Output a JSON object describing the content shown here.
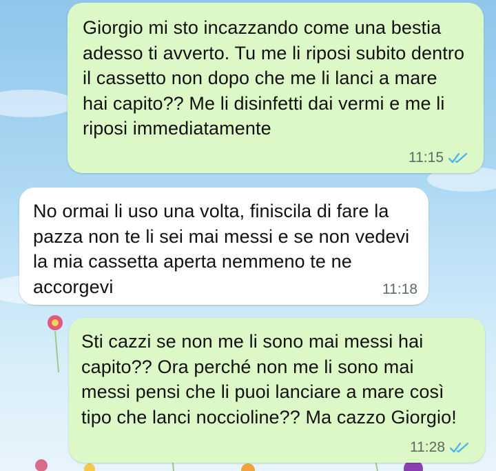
{
  "messages": [
    {
      "direction": "outgoing",
      "text": "Giorgio mi sto incazzando come una bestia adesso ti avverto. Tu me li riposi subito dentro il cassetto non dopo che me li lanci a mare hai capito?? Me li disinfetti dai vermi e me li riposi immediatamente",
      "time": "11:15",
      "status": "read"
    },
    {
      "direction": "incoming",
      "text": "No ormai li uso una volta, finiscila di fare la pazza non te li sei mai messi e se non vedevi la mia cassetta aperta nemmeno te ne accorgevi",
      "time": "11:18"
    },
    {
      "direction": "outgoing",
      "text": "Sti cazzi se non me li sono mai messi hai capito?? Ora perché non me li sono mai messi pensi che li puoi lanciare a mare così tipo che lanci noccioline?? Ma cazzo Giorgio!",
      "time": "11:28",
      "status": "read"
    }
  ],
  "colors": {
    "outgoing_bubble": "#dcf8c6",
    "incoming_bubble": "#ffffff",
    "read_ticks": "#4fb6ec",
    "timestamp": "#5c6b63"
  },
  "icons": {
    "read_receipt": "double-check-icon"
  }
}
